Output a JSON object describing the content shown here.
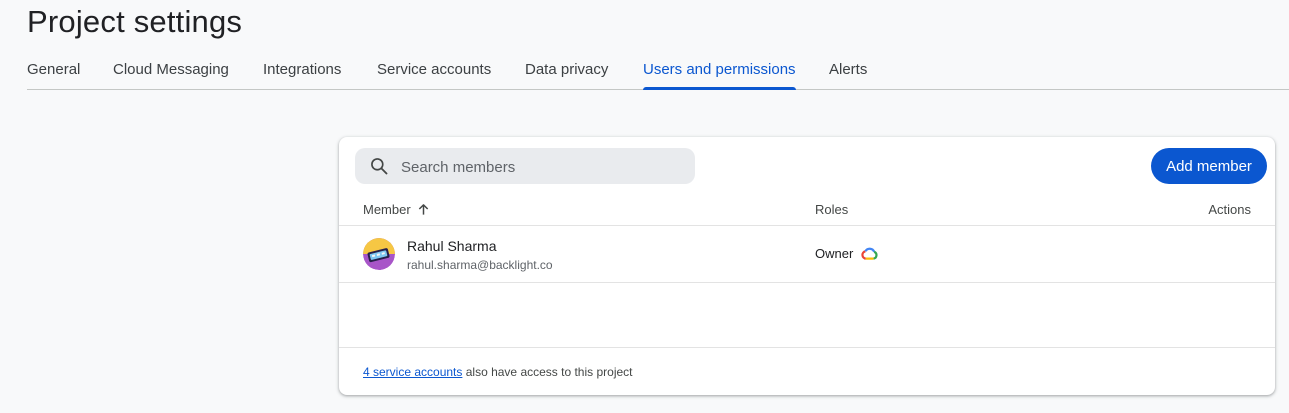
{
  "page": {
    "title": "Project settings"
  },
  "tabs": [
    {
      "label": "General"
    },
    {
      "label": "Cloud Messaging"
    },
    {
      "label": "Integrations"
    },
    {
      "label": "Service accounts"
    },
    {
      "label": "Data privacy"
    },
    {
      "label": "Users and permissions",
      "active": true
    },
    {
      "label": "Alerts"
    }
  ],
  "members_panel": {
    "search_placeholder": "Search members",
    "add_button_label": "Add member",
    "columns": {
      "member": "Member",
      "roles": "Roles",
      "actions": "Actions"
    },
    "sort": "member-ascending",
    "rows": [
      {
        "name": "Rahul Sharma",
        "email": "rahul.sharma@backlight.co",
        "role": "Owner",
        "role_icon": "google-cloud-icon"
      }
    ],
    "footer": {
      "link_text": "4 service accounts",
      "text": "also have access to this project"
    }
  },
  "colors": {
    "accent": "#0b57d0",
    "background": "#f8f9fa",
    "search_bg": "#e9ebee"
  }
}
